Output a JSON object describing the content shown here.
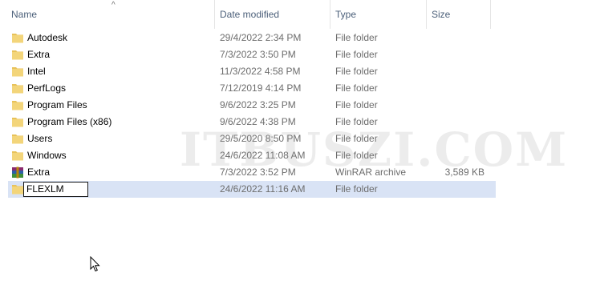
{
  "columns": {
    "name": "Name",
    "date": "Date modified",
    "type": "Type",
    "size": "Size"
  },
  "sort_indicator": "^",
  "files": [
    {
      "name": "Autodesk",
      "date": "29/4/2022 2:34 PM",
      "type": "File folder",
      "size": "",
      "icon": "folder-icon"
    },
    {
      "name": "Extra",
      "date": "7/3/2022 3:50 PM",
      "type": "File folder",
      "size": "",
      "icon": "folder-icon"
    },
    {
      "name": "Intel",
      "date": "11/3/2022 4:58 PM",
      "type": "File folder",
      "size": "",
      "icon": "folder-icon"
    },
    {
      "name": "PerfLogs",
      "date": "7/12/2019 4:14 PM",
      "type": "File folder",
      "size": "",
      "icon": "folder-icon"
    },
    {
      "name": "Program Files",
      "date": "9/6/2022 3:25 PM",
      "type": "File folder",
      "size": "",
      "icon": "folder-icon"
    },
    {
      "name": "Program Files (x86)",
      "date": "9/6/2022 4:38 PM",
      "type": "File folder",
      "size": "",
      "icon": "folder-icon"
    },
    {
      "name": "Users",
      "date": "29/5/2020 8:50 PM",
      "type": "File folder",
      "size": "",
      "icon": "folder-icon"
    },
    {
      "name": "Windows",
      "date": "24/6/2022 11:08 AM",
      "type": "File folder",
      "size": "",
      "icon": "folder-icon"
    },
    {
      "name": "Extra",
      "date": "7/3/2022 3:52 PM",
      "type": "WinRAR archive",
      "size": "3,589 KB",
      "icon": "winrar-archive-icon"
    },
    {
      "name": "FLEXLM",
      "date": "24/6/2022 11:16 AM",
      "type": "File folder",
      "size": "",
      "icon": "folder-icon",
      "renaming": true
    }
  ],
  "watermark": "ITBUSZI.COM",
  "colors": {
    "selection": "#cce8ff",
    "folder": "#e8c25a",
    "header_text": "#4c607a"
  }
}
